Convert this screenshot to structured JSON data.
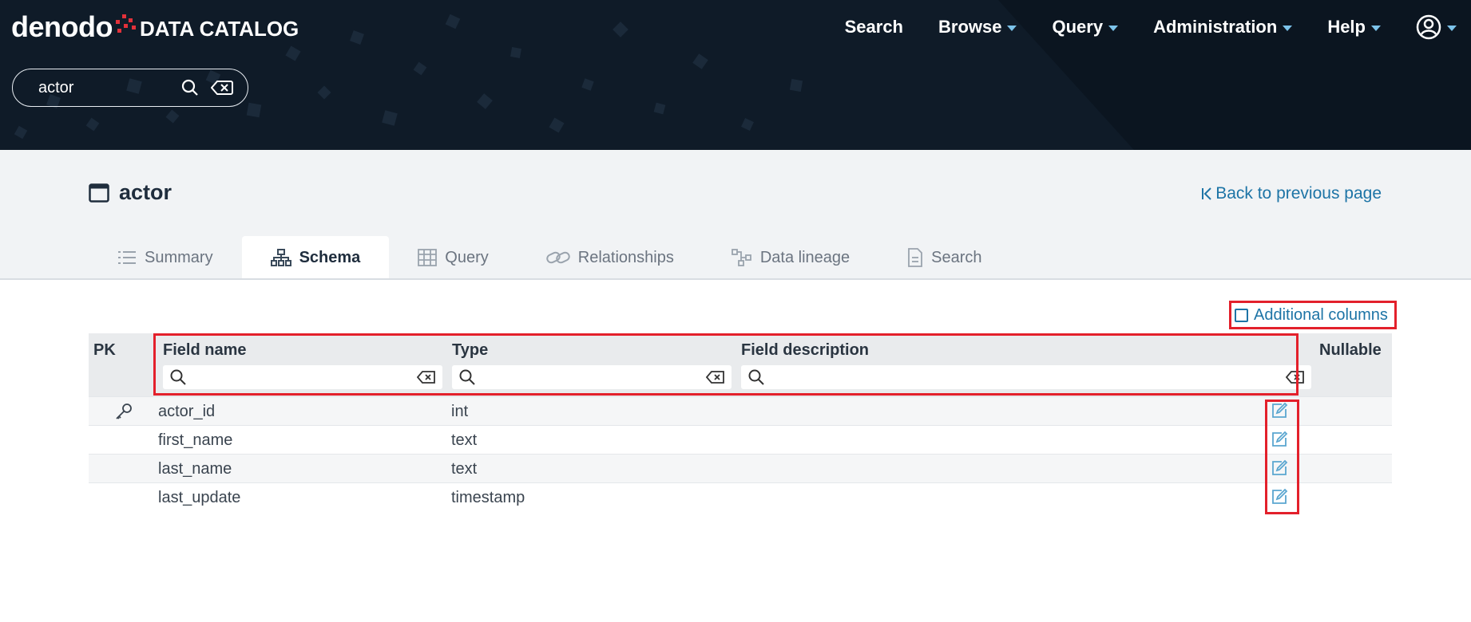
{
  "header": {
    "brand": "denodo",
    "product": "DATA CATALOG",
    "search_value": "actor",
    "nav": [
      {
        "label": "Search",
        "caret": false
      },
      {
        "label": "Browse",
        "caret": true
      },
      {
        "label": "Query",
        "caret": true
      },
      {
        "label": "Administration",
        "caret": true
      },
      {
        "label": "Help",
        "caret": true
      }
    ],
    "user_icon": "user-circle-icon"
  },
  "page": {
    "title": "actor",
    "title_icon": "view-window-icon",
    "back_label": "Back to previous page"
  },
  "tabs": [
    {
      "label": "Summary",
      "icon": "list-icon",
      "active": false
    },
    {
      "label": "Schema",
      "icon": "hierarchy-icon",
      "active": true
    },
    {
      "label": "Query",
      "icon": "grid-icon",
      "active": false
    },
    {
      "label": "Relationships",
      "icon": "link-icon",
      "active": false
    },
    {
      "label": "Data lineage",
      "icon": "lineage-icon",
      "active": false
    },
    {
      "label": "Search",
      "icon": "document-icon",
      "active": false
    }
  ],
  "schema": {
    "additional_columns_label": "Additional columns",
    "additional_columns_checked": false,
    "columns": {
      "pk": "PK",
      "field_name": "Field name",
      "type": "Type",
      "description": "Field description",
      "nullable": "Nullable"
    },
    "rows": [
      {
        "pk": true,
        "field": "actor_id",
        "type": "int",
        "description": ""
      },
      {
        "pk": false,
        "field": "first_name",
        "type": "text",
        "description": ""
      },
      {
        "pk": false,
        "field": "last_name",
        "type": "text",
        "description": ""
      },
      {
        "pk": false,
        "field": "last_update",
        "type": "timestamp",
        "description": ""
      }
    ]
  },
  "colors": {
    "header_bg": "#0f1b28",
    "accent": "#1d74a6",
    "highlight": "#e3202b",
    "caret": "#7cc3ea"
  }
}
